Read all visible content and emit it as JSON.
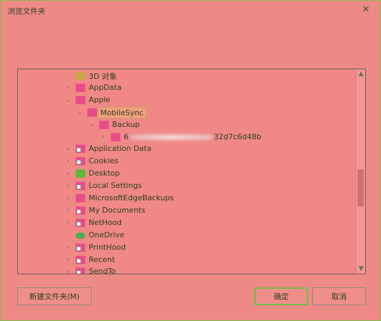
{
  "dialog": {
    "title": "浏览文件夹",
    "close_glyph": "✕"
  },
  "tree": {
    "rows": [
      {
        "label": "3D 对象",
        "expander": "",
        "icon": "cube-icon",
        "link": false,
        "selected": false
      },
      {
        "label": "AppData",
        "expander": "›",
        "icon": "folder-icon",
        "link": false,
        "selected": false
      },
      {
        "label": "Apple",
        "expander": "⌄",
        "icon": "folder-icon",
        "link": false,
        "selected": false
      },
      {
        "label": "MobileSync",
        "expander": "⌄",
        "icon": "folder-icon",
        "link": false,
        "selected": true
      },
      {
        "label": "Backup",
        "expander": "⌄",
        "icon": "folder-icon",
        "link": false,
        "selected": false
      },
      {
        "label_start": "6",
        "label_end": "32d7c6d48b",
        "expander": "›",
        "icon": "folder-icon",
        "link": false,
        "selected": false
      },
      {
        "label": "Application Data",
        "expander": "›",
        "icon": "folder-shortcut-icon",
        "link": true,
        "selected": false
      },
      {
        "label": "Cookies",
        "expander": "›",
        "icon": "folder-shortcut-icon",
        "link": true,
        "selected": false
      },
      {
        "label": "Desktop",
        "expander": "›",
        "icon": "desktop-icon",
        "link": false,
        "selected": false
      },
      {
        "label": "Local Settings",
        "expander": "›",
        "icon": "folder-shortcut-icon",
        "link": true,
        "selected": false
      },
      {
        "label": "MicrosoftEdgeBackups",
        "expander": "›",
        "icon": "folder-icon",
        "link": false,
        "selected": false
      },
      {
        "label": "My Documents",
        "expander": "›",
        "icon": "folder-shortcut-icon",
        "link": true,
        "selected": false
      },
      {
        "label": "NetHood",
        "expander": "›",
        "icon": "folder-shortcut-icon",
        "link": true,
        "selected": false
      },
      {
        "label": "OneDrive",
        "expander": "",
        "icon": "cloud-icon",
        "link": false,
        "selected": false
      },
      {
        "label": "PrintHood",
        "expander": "›",
        "icon": "folder-shortcut-icon",
        "link": true,
        "selected": false
      },
      {
        "label": "Recent",
        "expander": "›",
        "icon": "folder-shortcut-icon",
        "link": true,
        "selected": false
      },
      {
        "label": "SendTo",
        "expander": "›",
        "icon": "folder-shortcut-icon",
        "link": true,
        "selected": false
      }
    ],
    "scroll_up": "▲",
    "scroll_down": "▼"
  },
  "buttons": {
    "new_folder": "新建文件夹(M)",
    "ok": "确定",
    "cancel": "取消"
  }
}
